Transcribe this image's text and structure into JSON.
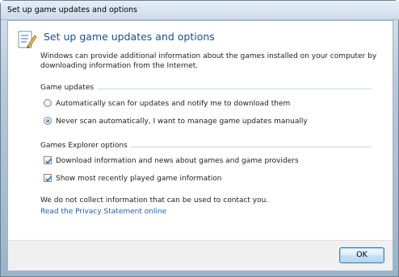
{
  "window": {
    "title": "Set up game updates and options"
  },
  "header": {
    "title": "Set up game updates and options",
    "icon": "checklist-pencil-icon"
  },
  "intro": {
    "text": "Windows can provide additional information about the games installed on your computer by downloading information from the Internet."
  },
  "game_updates": {
    "label": "Game updates",
    "options": [
      {
        "label": "Automatically scan for updates and notify me to download them",
        "selected": false
      },
      {
        "label": "Never scan automatically, I want to manage game updates manually",
        "selected": true
      }
    ]
  },
  "games_explorer": {
    "label": "Games Explorer options",
    "options": [
      {
        "label": "Download information and news about games and game providers",
        "checked": true
      },
      {
        "label": "Show most recently played game information",
        "checked": true
      }
    ]
  },
  "privacy": {
    "disclaimer": "We do not collect information that can be used to contact you.",
    "link_text": "Read the Privacy Statement online"
  },
  "footer": {
    "ok_label": "OK"
  },
  "colors": {
    "title_blue": "#1f4b93",
    "link_blue": "#1f5fb0",
    "radio_selected": "#1f6fb2"
  }
}
